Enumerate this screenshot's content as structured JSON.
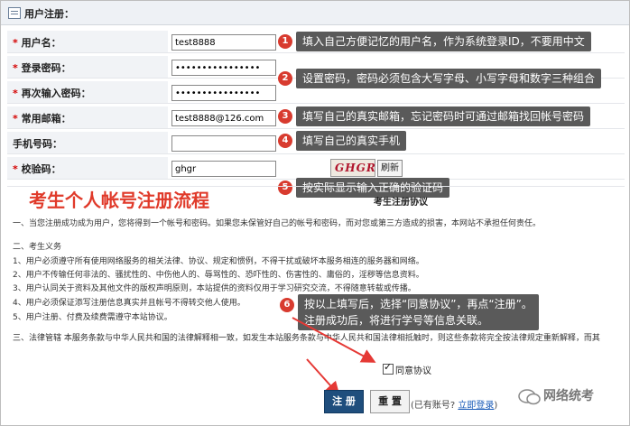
{
  "panel": {
    "title": "用户注册："
  },
  "fields": {
    "username": {
      "label": "用户名：",
      "value": "test8888"
    },
    "password": {
      "label": "登录密码：",
      "value": "••••••••••••••••"
    },
    "password2": {
      "label": "再次输入密码：",
      "value": "••••••••••••••••"
    },
    "email": {
      "label": "常用邮箱：",
      "value": "test8888@126.com"
    },
    "mobile": {
      "label": "手机号码：",
      "value": ""
    },
    "captcha": {
      "label": "校验码：",
      "value": "ghgr",
      "image_text": "GHGR",
      "refresh": "刷新"
    }
  },
  "annotations": [
    {
      "n": "1",
      "text": "填入自己方便记忆的用户名，作为系统登录ID，不要用中文"
    },
    {
      "n": "2",
      "text": "设置密码，密码必须包含大写字母、小写字母和数字三种组合"
    },
    {
      "n": "3",
      "text": "填写自己的真实邮箱，忘记密码时可通过邮箱找回帐号密码"
    },
    {
      "n": "4",
      "text": "填写自己的真实手机"
    },
    {
      "n": "5",
      "text": "按实际显示输入正确的验证码"
    },
    {
      "n": "6",
      "line1": "按以上填写后，选择“同意协议”，再点“注册”。",
      "line2": "注册成功后，将进行学号等信息关联。"
    }
  ],
  "overlay_title": "考生个人帐号注册流程",
  "agreement": {
    "heading": "考生注册协议",
    "lines": [
      "一、当您注册成功成为用户，您将得到一个帐号和密码。如果您未保管好自己的帐号和密码，而对您或第三方造成的损害，本网站不承担任何责任。",
      "二、考生义务",
      "1、用户必须遵守所有使用网络服务的相关法律、协议、规定和惯例，不得干扰或破坏本服务相连的服务器和网络。",
      "2、用户不传输任何非法的、骚扰性的、中伤他人的、辱骂性的、恐吓性的、伤害性的、庸俗的，淫秽等信息资料。",
      "3、用户认同关于资料及其他文件的版权声明原则，本站提供的资料仅用于学习研究交流，不得随意转载或传播。",
      "4、用户必须保证添写注册信息真实并且帐号不得转交他人使用。",
      "5、用户注册、付费及续费需遵守本站协议。",
      "三、法律管辖 本服务条款与中华人民共和国的法律解释相一致，如发生本站服务条款与中华人民共和国法律相抵触时，则这些条款将完全按法律规定重新解释，而其"
    ]
  },
  "agree_label": "同意协议",
  "buttons": {
    "register": "注 册",
    "reset": "重 置"
  },
  "login_prompt": {
    "prefix": "(已有账号?",
    "link": "立即登录",
    "suffix": ")"
  },
  "watermark": "网络统考"
}
